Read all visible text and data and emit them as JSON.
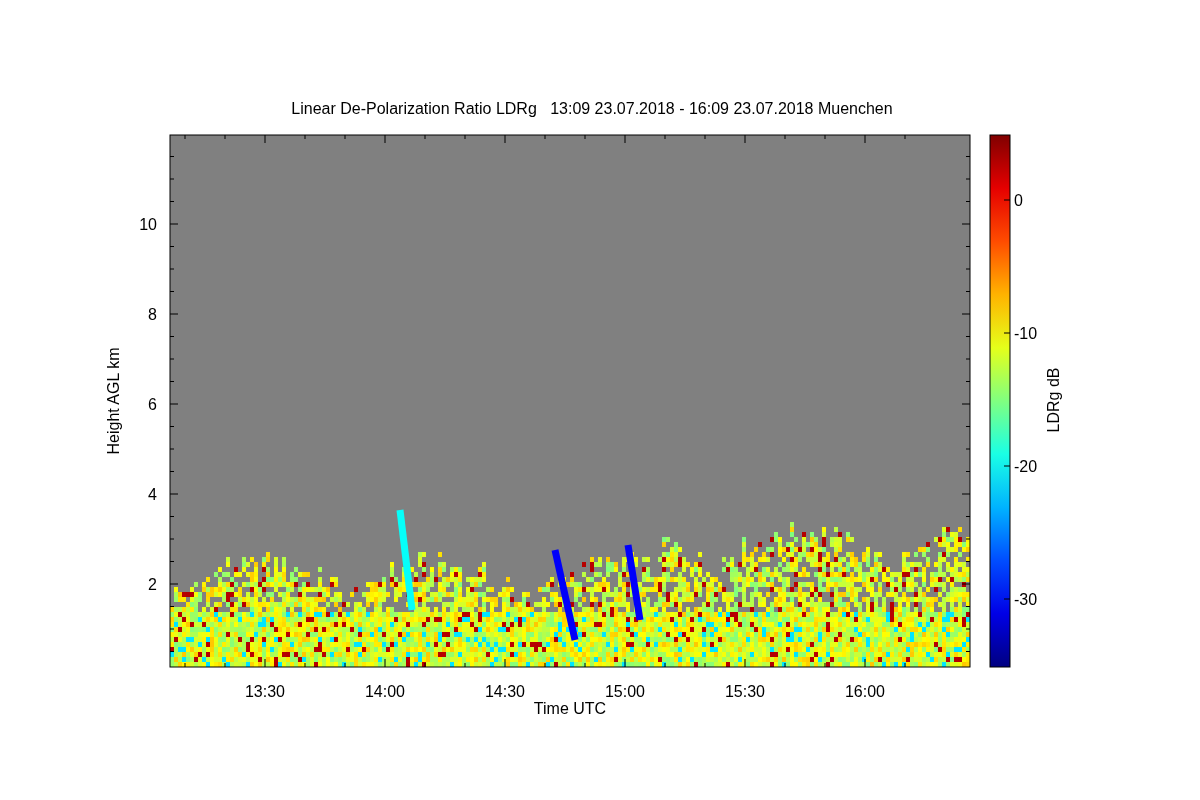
{
  "title": "Linear De-Polarization Ratio LDRg   13:09 23.07.2018 - 16:09 23.07.2018 Muenchen",
  "plot": {
    "ylabel": "Height AGL km",
    "xlabel": "Time UTC",
    "yticks": [
      "10",
      "8",
      "6",
      "4",
      "2"
    ],
    "xticks": [
      "13:30",
      "14:00",
      "14:30",
      "15:00",
      "15:30",
      "16:00"
    ]
  },
  "colorbar": {
    "label": "LDRg dB",
    "ticks": [
      "0",
      "-10",
      "-20",
      "-30"
    ]
  }
}
